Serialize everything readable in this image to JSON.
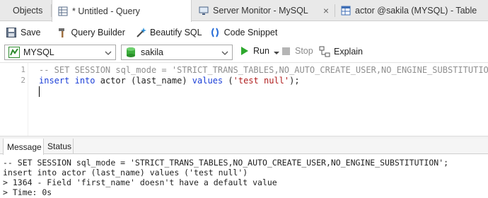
{
  "tabs": [
    {
      "label": "Objects",
      "icon": "none"
    },
    {
      "label": "* Untitled - Query",
      "icon": "query-grid-icon"
    },
    {
      "label": "Server Monitor - MySQL",
      "icon": "monitor-icon"
    },
    {
      "label": "actor @sakila (MYSQL) - Table",
      "icon": "table-icon"
    }
  ],
  "toolbar": {
    "save": "Save",
    "query_builder": "Query Builder",
    "beautify": "Beautify SQL",
    "snippet": "Code Snippet"
  },
  "connection": {
    "value": "MYSQL"
  },
  "database": {
    "value": "sakila"
  },
  "actions": {
    "run": "Run",
    "stop": "Stop",
    "explain": "Explain"
  },
  "editor": {
    "line_numbers": [
      "1",
      "2"
    ],
    "line1_comment": "-- SET SESSION sql_mode = 'STRICT_TRANS_TABLES,NO_AUTO_CREATE_USER,NO_ENGINE_SUBSTITUTION';",
    "line2": {
      "kw_insert": "insert",
      "kw_into": "into",
      "table": "actor (last_name)",
      "kw_values": "values",
      "open": "(",
      "string": "'test null'",
      "close": ");"
    }
  },
  "bottom_tabs": {
    "message": "Message",
    "status": "Status"
  },
  "messages": [
    "-- SET SESSION sql_mode = 'STRICT_TRANS_TABLES,NO_AUTO_CREATE_USER,NO_ENGINE_SUBSTITUTION';",
    "insert into actor (last_name) values ('test null')",
    "> 1364 - Field 'first_name' doesn't have a default value",
    "> Time: 0s"
  ],
  "colors": {
    "keyword": "#1b3fd8",
    "string": "#b01e1e",
    "comment": "#8f8f8f",
    "run_green": "#2ea82e"
  }
}
